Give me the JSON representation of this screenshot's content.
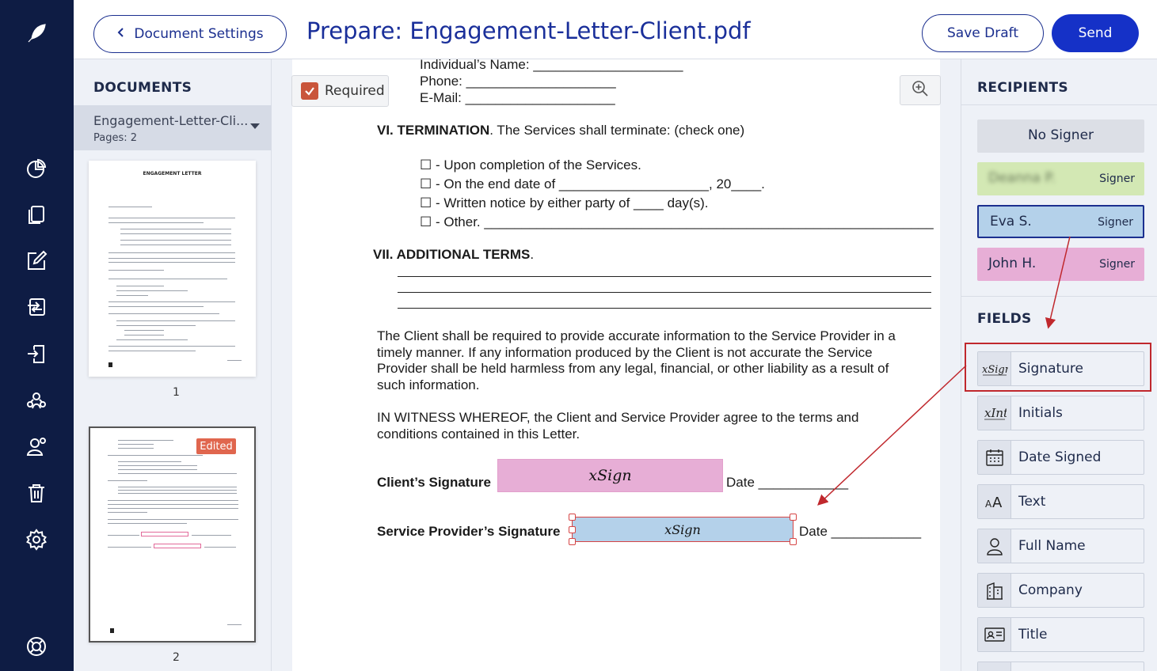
{
  "header": {
    "back_label": "Document Settings",
    "title": "Prepare: Engagement-Letter-Client.pdf",
    "save_draft": "Save Draft",
    "send": "Send"
  },
  "nav_icons": [
    "feather-logo-icon",
    "pie-chart-icon",
    "documents-icon",
    "edit-icon",
    "transfer-icon",
    "import-icon",
    "team-icon",
    "contacts-icon",
    "trash-icon",
    "settings-icon",
    "help-icon"
  ],
  "documents": {
    "heading": "DOCUMENTS",
    "selected_name": "Engagement-Letter-Cli...",
    "pages_label": "Pages: 2",
    "thumb1_title": "ENGAGEMENT LETTER",
    "page1": "1",
    "page2": "2",
    "edited_badge": "Edited"
  },
  "canvas": {
    "required_label": "Required",
    "individual_name": "Individual’s Name: ____________________",
    "phone": "Phone: ____________________",
    "email": "E-Mail: ____________________",
    "termination_head": "VI. TERMINATION",
    "termination_text": ". The Services shall terminate: (check one)",
    "opt1": "☐ - Upon completion of the Services.",
    "opt2": "☐ - On the end date of ____________________, 20____.",
    "opt3": "☐ - Written notice by either party of ____ day(s).",
    "opt4": "☐ - Other. ____________________________________________________________",
    "additional_head": "VII. ADDITIONAL TERMS",
    "additional_dot": ".",
    "para1_l1": "The Client shall be required to provide accurate information to the Service Provider in a",
    "para1_l2": "timely manner. If any information produced by the Client is not accurate the Service",
    "para1_l3": "Provider shall be held harmless from any legal, financial, or other liability as a result of",
    "para1_l4": "such information.",
    "para2_l1": "IN WITNESS WHEREOF, the Client and Service Provider agree to the terms and",
    "para2_l2": "conditions contained in this Letter.",
    "client_sig_label": "Client’s Signature",
    "date1": "Date ____________",
    "provider_sig_label": "Service Provider’s Signature",
    "date2": "Date ____________",
    "sign_mark": "xSign"
  },
  "recipients": {
    "heading": "RECIPIENTS",
    "items": [
      {
        "name": "No Signer",
        "role": "",
        "color": "#dcdfe6"
      },
      {
        "name": "Deanna P.",
        "role": "Signer",
        "color": "#d3e8b4"
      },
      {
        "name": "Eva S.",
        "role": "Signer",
        "color": "#b4d1ea"
      },
      {
        "name": "John H.",
        "role": "Signer",
        "color": "#e7aed6"
      }
    ]
  },
  "fields": {
    "heading": "FIELDS",
    "items": [
      {
        "label": "Signature",
        "icon": "signature-icon"
      },
      {
        "label": "Initials",
        "icon": "initials-icon"
      },
      {
        "label": "Date Signed",
        "icon": "calendar-icon"
      },
      {
        "label": "Text",
        "icon": "text-icon"
      },
      {
        "label": "Full Name",
        "icon": "person-icon"
      },
      {
        "label": "Company",
        "icon": "building-icon"
      },
      {
        "label": "Title",
        "icon": "id-card-icon"
      }
    ]
  },
  "colors": {
    "navy": "#0e1c44",
    "brand_blue": "#1531c7",
    "annotation_red": "#c0282d"
  }
}
